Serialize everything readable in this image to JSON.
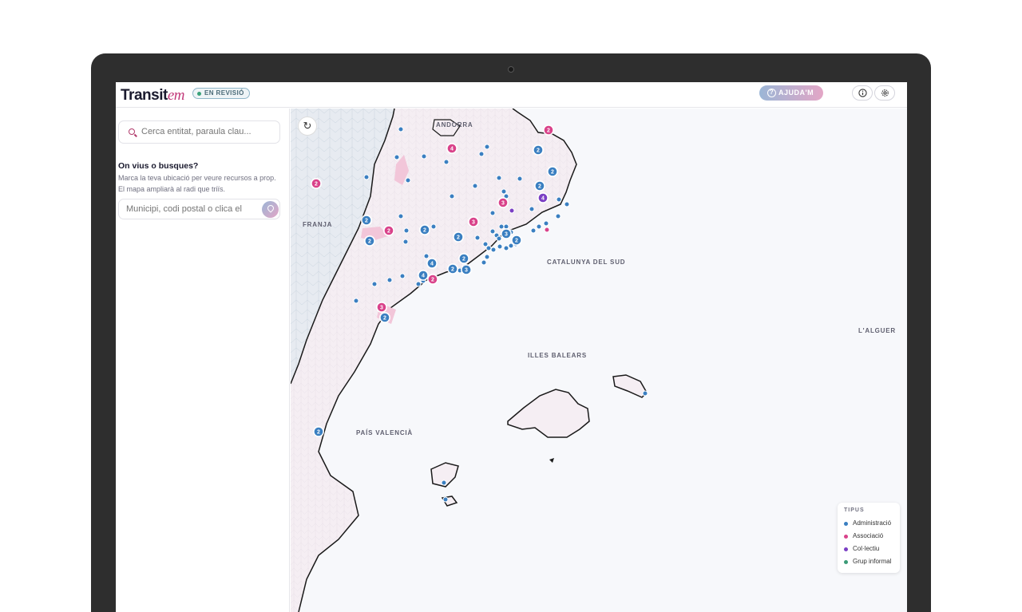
{
  "app": {
    "logo_main": "Transit",
    "logo_em": "em",
    "status_badge": "EN REVISIÓ"
  },
  "header": {
    "help_label": "AJUDA'M",
    "help_icon": "question-circle-icon",
    "map_icon": "map-icon",
    "info_icon": "info-icon",
    "settings_icon": "gear-icon"
  },
  "sidebar": {
    "search_placeholder": "Cerca entitat, paraula clau...",
    "locate_title": "On vius o busques?",
    "locate_desc": "Marca la teva ubicació per veure recursos a prop. El mapa ampliarà al radi que triïs.",
    "location_placeholder": "Municipi, codi postal o clica el"
  },
  "map": {
    "labels": [
      {
        "text": "ANDORRA"
      },
      {
        "text": "FRANJA"
      },
      {
        "text": "CATALUNYA DEL SUD"
      },
      {
        "text": "L'ALGUER"
      },
      {
        "text": "ILLES BALEARS"
      },
      {
        "text": "PAÍS VALENCIÀ"
      }
    ],
    "cluster_counts": [
      "2",
      "4",
      "2",
      "2",
      "2",
      "4",
      "2",
      "3",
      "2",
      "3",
      "2",
      "2",
      "2",
      "2",
      "3",
      "2",
      "4",
      "2",
      "4",
      "2",
      "2",
      "3",
      "3",
      "2",
      "2"
    ],
    "legend": {
      "title": "TIPUS",
      "items": [
        {
          "label": "Administració",
          "color": "#3a7fc1"
        },
        {
          "label": "Associació",
          "color": "#d9428a"
        },
        {
          "label": "Col·lectiu",
          "color": "#7b3fc4"
        },
        {
          "label": "Grup informal",
          "color": "#3a9a76"
        }
      ]
    }
  },
  "colors": {
    "admin": "#3a7fc1",
    "assoc": "#d9428a",
    "collectiu": "#7b3fc4",
    "grup": "#3a9a76",
    "accent": "#c23a7a"
  }
}
